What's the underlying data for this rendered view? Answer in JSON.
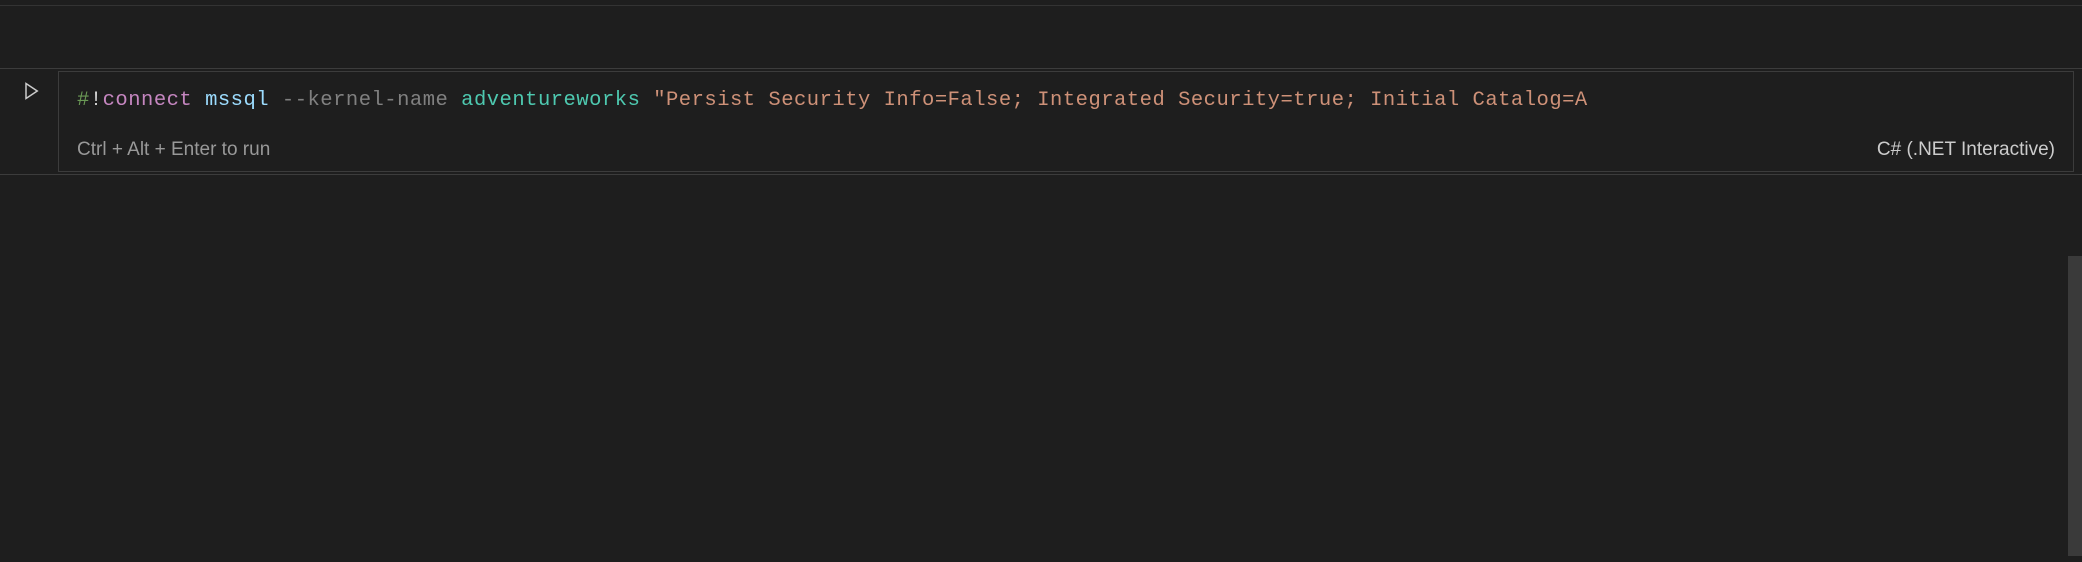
{
  "cell": {
    "code": {
      "hash": "#",
      "bang": "!",
      "connect": "connect",
      "mssql": "mssql",
      "flag": "--kernel-name",
      "arg": "adventureworks",
      "string": "\"Persist Security Info=False; Integrated Security=true; Initial Catalog=A"
    },
    "footer": {
      "hint": "Ctrl + Alt + Enter to run",
      "kernel": "C# (.NET Interactive)"
    }
  }
}
